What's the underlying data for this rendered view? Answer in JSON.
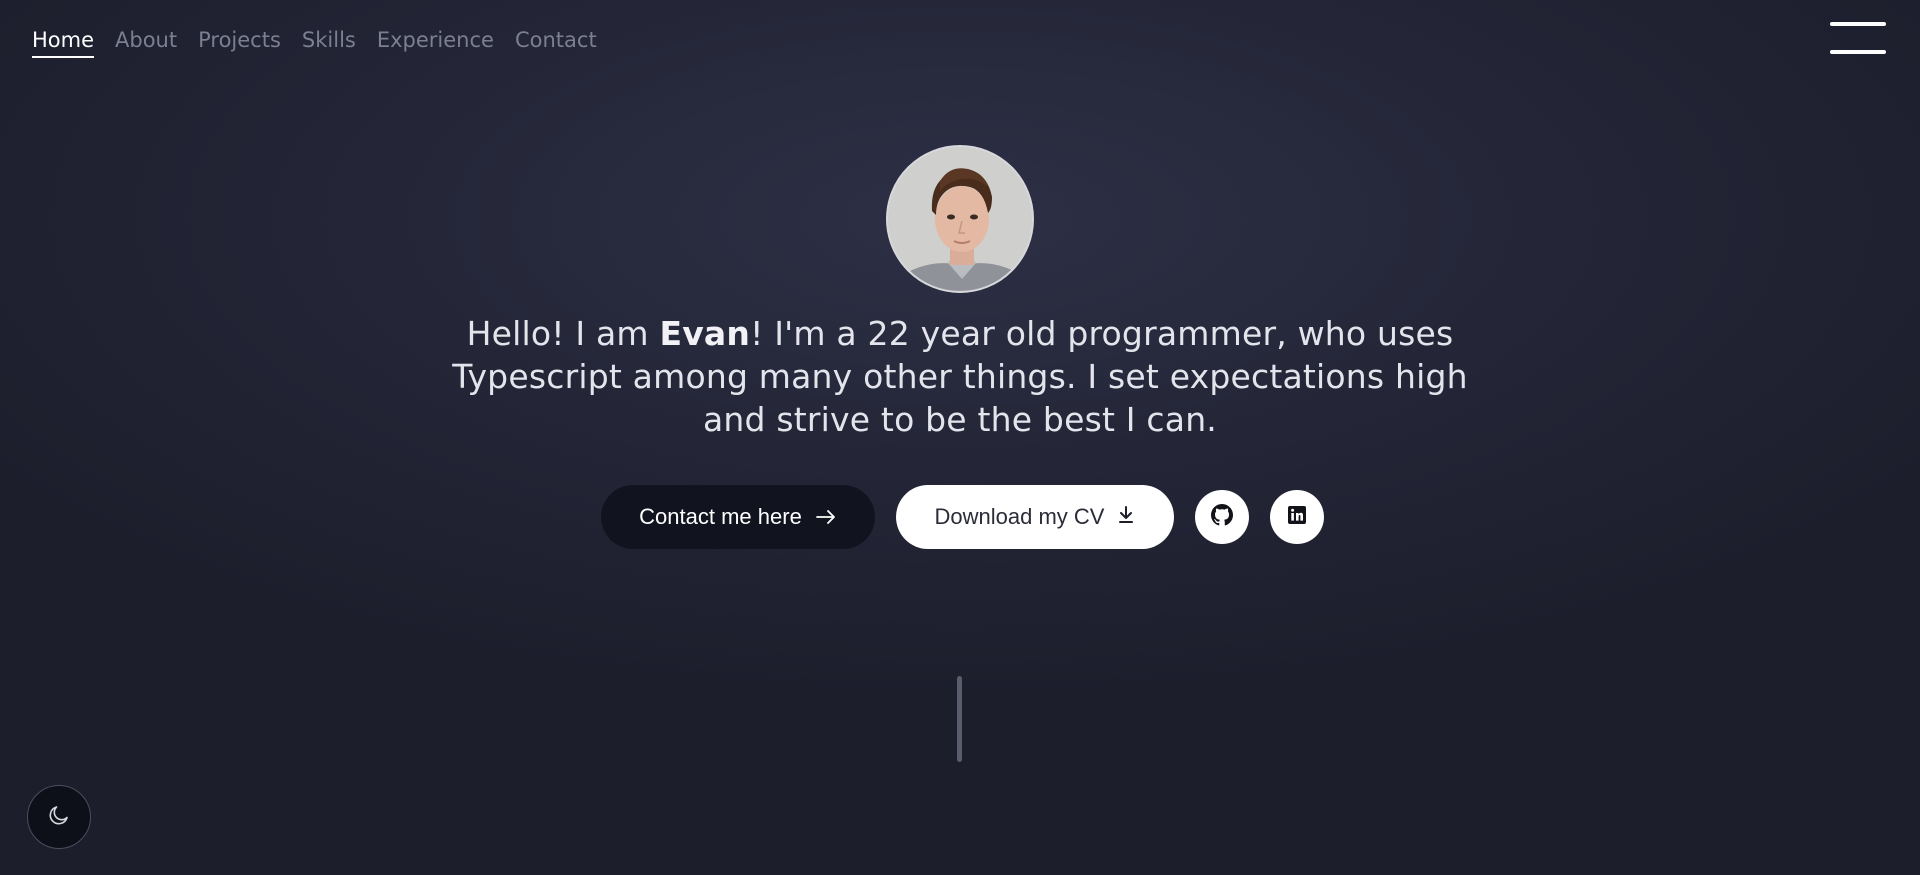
{
  "nav": {
    "items": [
      {
        "label": "Home",
        "active": true
      },
      {
        "label": "About",
        "active": false
      },
      {
        "label": "Projects",
        "active": false
      },
      {
        "label": "Skills",
        "active": false
      },
      {
        "label": "Experience",
        "active": false
      },
      {
        "label": "Contact",
        "active": false
      }
    ],
    "menu_icon": "hamburger-menu-icon"
  },
  "hero": {
    "avatar_alt": "profile photo",
    "intro_before": "Hello! I am ",
    "intro_name": "Evan",
    "intro_after": "! I'm a 22 year old programmer, who uses Typescript among many other things. I set expectations high and strive to be the best I can."
  },
  "actions": {
    "contact_label": "Contact me here",
    "contact_icon": "arrow-right-icon",
    "cv_label": "Download my CV",
    "cv_icon": "download-icon",
    "github_icon": "github-icon",
    "linkedin_icon": "linkedin-icon"
  },
  "theme_toggle": {
    "icon": "moon-icon"
  },
  "colors": {
    "background": "#252739",
    "nav_inactive": "#7c7f90",
    "contact_button": "#11141f",
    "cv_button": "#ffffff"
  }
}
